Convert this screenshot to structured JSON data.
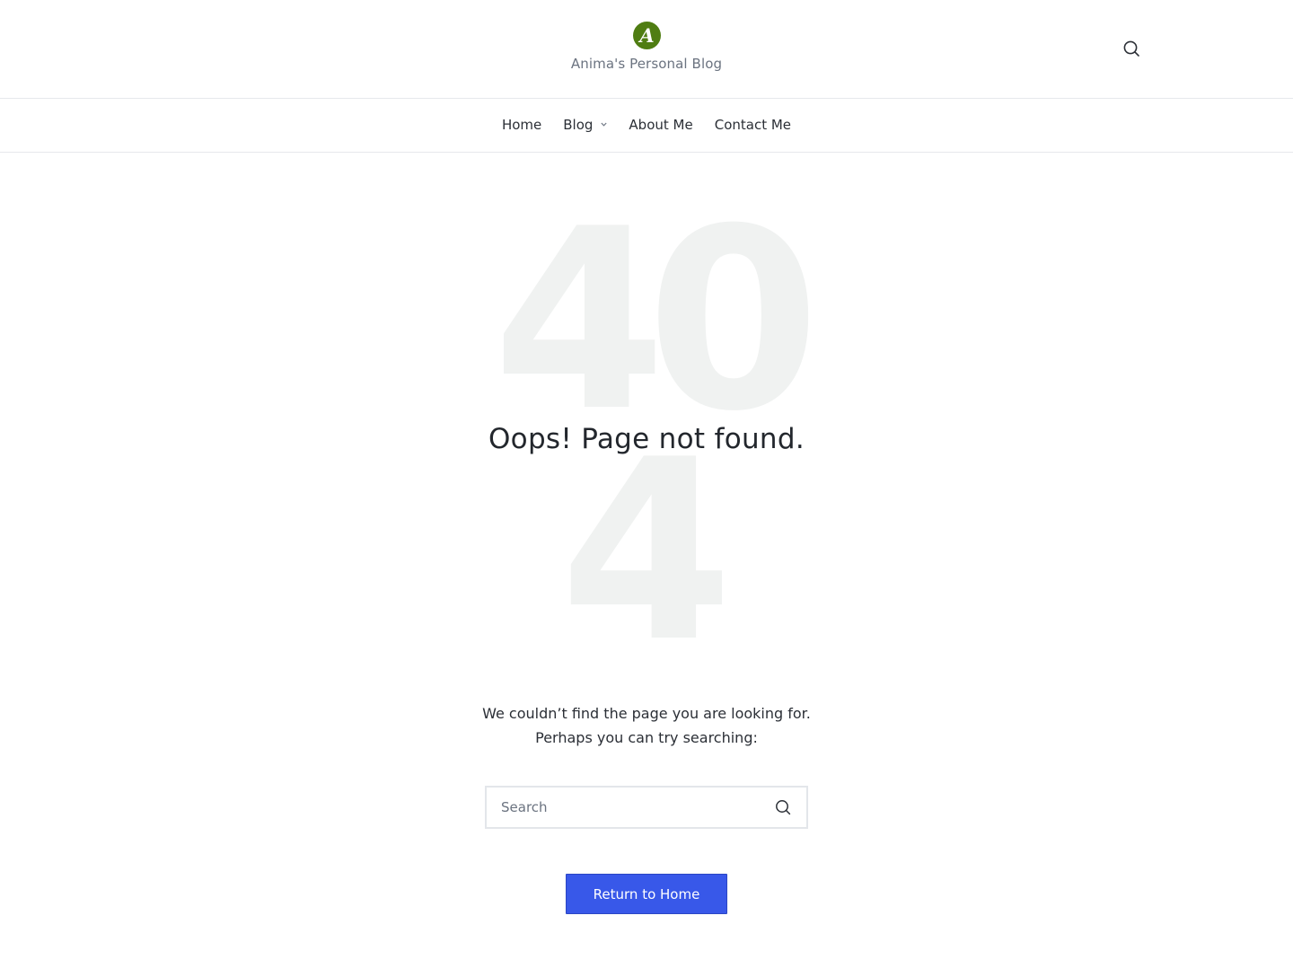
{
  "header": {
    "logo_letter": "A",
    "tagline": "Anima's Personal Blog",
    "search_icon": "search-icon"
  },
  "nav": {
    "items": [
      {
        "label": "Home"
      },
      {
        "label": "Blog",
        "has_dropdown": true
      },
      {
        "label": "About Me"
      },
      {
        "label": "Contact Me"
      }
    ]
  },
  "error": {
    "big_top": "40",
    "big_bottom": "4",
    "headline": "Oops! Page not found.",
    "message_line1": "We couldn’t find the page you are looking for.",
    "message_line2": "Perhaps you can try searching:"
  },
  "search": {
    "placeholder": "Search",
    "value": ""
  },
  "cta": {
    "label": "Return to Home"
  },
  "colors": {
    "brand_green": "#4f7d12",
    "accent_blue": "#3858e9",
    "ghost_digits": "#f0f2f1"
  }
}
